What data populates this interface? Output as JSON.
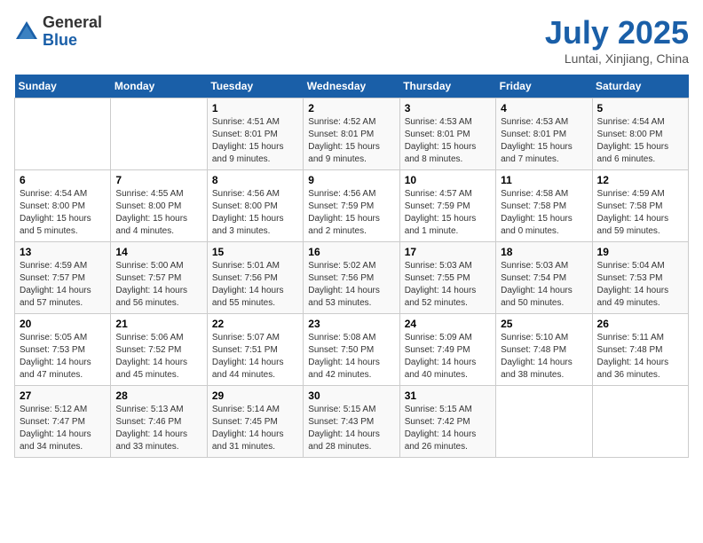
{
  "logo": {
    "general": "General",
    "blue": "Blue"
  },
  "title": "July 2025",
  "location": "Luntai, Xinjiang, China",
  "days_of_week": [
    "Sunday",
    "Monday",
    "Tuesday",
    "Wednesday",
    "Thursday",
    "Friday",
    "Saturday"
  ],
  "weeks": [
    [
      {
        "day": "",
        "info": ""
      },
      {
        "day": "",
        "info": ""
      },
      {
        "day": "1",
        "info": "Sunrise: 4:51 AM\nSunset: 8:01 PM\nDaylight: 15 hours and 9 minutes."
      },
      {
        "day": "2",
        "info": "Sunrise: 4:52 AM\nSunset: 8:01 PM\nDaylight: 15 hours and 9 minutes."
      },
      {
        "day": "3",
        "info": "Sunrise: 4:53 AM\nSunset: 8:01 PM\nDaylight: 15 hours and 8 minutes."
      },
      {
        "day": "4",
        "info": "Sunrise: 4:53 AM\nSunset: 8:01 PM\nDaylight: 15 hours and 7 minutes."
      },
      {
        "day": "5",
        "info": "Sunrise: 4:54 AM\nSunset: 8:00 PM\nDaylight: 15 hours and 6 minutes."
      }
    ],
    [
      {
        "day": "6",
        "info": "Sunrise: 4:54 AM\nSunset: 8:00 PM\nDaylight: 15 hours and 5 minutes."
      },
      {
        "day": "7",
        "info": "Sunrise: 4:55 AM\nSunset: 8:00 PM\nDaylight: 15 hours and 4 minutes."
      },
      {
        "day": "8",
        "info": "Sunrise: 4:56 AM\nSunset: 8:00 PM\nDaylight: 15 hours and 3 minutes."
      },
      {
        "day": "9",
        "info": "Sunrise: 4:56 AM\nSunset: 7:59 PM\nDaylight: 15 hours and 2 minutes."
      },
      {
        "day": "10",
        "info": "Sunrise: 4:57 AM\nSunset: 7:59 PM\nDaylight: 15 hours and 1 minute."
      },
      {
        "day": "11",
        "info": "Sunrise: 4:58 AM\nSunset: 7:58 PM\nDaylight: 15 hours and 0 minutes."
      },
      {
        "day": "12",
        "info": "Sunrise: 4:59 AM\nSunset: 7:58 PM\nDaylight: 14 hours and 59 minutes."
      }
    ],
    [
      {
        "day": "13",
        "info": "Sunrise: 4:59 AM\nSunset: 7:57 PM\nDaylight: 14 hours and 57 minutes."
      },
      {
        "day": "14",
        "info": "Sunrise: 5:00 AM\nSunset: 7:57 PM\nDaylight: 14 hours and 56 minutes."
      },
      {
        "day": "15",
        "info": "Sunrise: 5:01 AM\nSunset: 7:56 PM\nDaylight: 14 hours and 55 minutes."
      },
      {
        "day": "16",
        "info": "Sunrise: 5:02 AM\nSunset: 7:56 PM\nDaylight: 14 hours and 53 minutes."
      },
      {
        "day": "17",
        "info": "Sunrise: 5:03 AM\nSunset: 7:55 PM\nDaylight: 14 hours and 52 minutes."
      },
      {
        "day": "18",
        "info": "Sunrise: 5:03 AM\nSunset: 7:54 PM\nDaylight: 14 hours and 50 minutes."
      },
      {
        "day": "19",
        "info": "Sunrise: 5:04 AM\nSunset: 7:53 PM\nDaylight: 14 hours and 49 minutes."
      }
    ],
    [
      {
        "day": "20",
        "info": "Sunrise: 5:05 AM\nSunset: 7:53 PM\nDaylight: 14 hours and 47 minutes."
      },
      {
        "day": "21",
        "info": "Sunrise: 5:06 AM\nSunset: 7:52 PM\nDaylight: 14 hours and 45 minutes."
      },
      {
        "day": "22",
        "info": "Sunrise: 5:07 AM\nSunset: 7:51 PM\nDaylight: 14 hours and 44 minutes."
      },
      {
        "day": "23",
        "info": "Sunrise: 5:08 AM\nSunset: 7:50 PM\nDaylight: 14 hours and 42 minutes."
      },
      {
        "day": "24",
        "info": "Sunrise: 5:09 AM\nSunset: 7:49 PM\nDaylight: 14 hours and 40 minutes."
      },
      {
        "day": "25",
        "info": "Sunrise: 5:10 AM\nSunset: 7:48 PM\nDaylight: 14 hours and 38 minutes."
      },
      {
        "day": "26",
        "info": "Sunrise: 5:11 AM\nSunset: 7:48 PM\nDaylight: 14 hours and 36 minutes."
      }
    ],
    [
      {
        "day": "27",
        "info": "Sunrise: 5:12 AM\nSunset: 7:47 PM\nDaylight: 14 hours and 34 minutes."
      },
      {
        "day": "28",
        "info": "Sunrise: 5:13 AM\nSunset: 7:46 PM\nDaylight: 14 hours and 33 minutes."
      },
      {
        "day": "29",
        "info": "Sunrise: 5:14 AM\nSunset: 7:45 PM\nDaylight: 14 hours and 31 minutes."
      },
      {
        "day": "30",
        "info": "Sunrise: 5:15 AM\nSunset: 7:43 PM\nDaylight: 14 hours and 28 minutes."
      },
      {
        "day": "31",
        "info": "Sunrise: 5:15 AM\nSunset: 7:42 PM\nDaylight: 14 hours and 26 minutes."
      },
      {
        "day": "",
        "info": ""
      },
      {
        "day": "",
        "info": ""
      }
    ]
  ]
}
